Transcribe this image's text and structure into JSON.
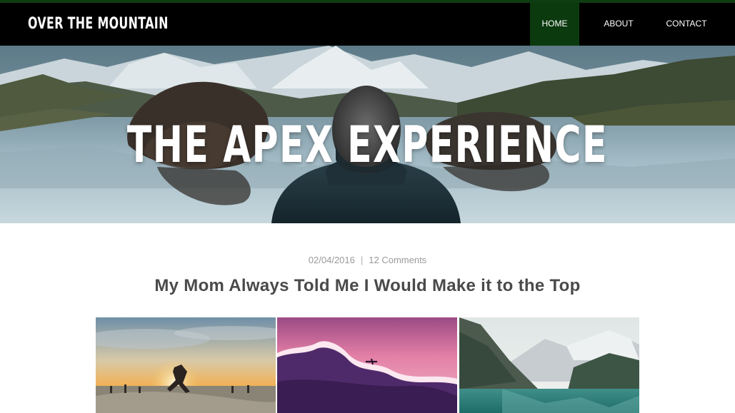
{
  "site": {
    "title": "OVER THE MOUNTAIN"
  },
  "nav": {
    "items": [
      {
        "label": "HOME",
        "active": true
      },
      {
        "label": "ABOUT",
        "active": false
      },
      {
        "label": "CONTACT",
        "active": false
      }
    ]
  },
  "hero": {
    "title": "THE APEX EXPERIENCE"
  },
  "post": {
    "date": "02/04/2016",
    "separator": "|",
    "comments": "12 Comments",
    "title": "My Mom Always Told Me I Would Make it to the Top"
  },
  "colors": {
    "nav_bg": "#000000",
    "nav_active": "#0c3a0f",
    "accent_strip": "#0e3d12"
  }
}
